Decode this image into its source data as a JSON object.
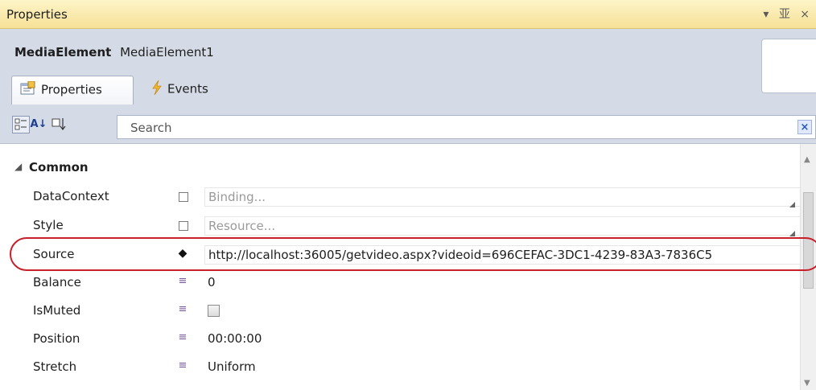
{
  "window": {
    "title": "Properties",
    "icons": {
      "dropdown": "▾",
      "pin": "业",
      "close": "×"
    }
  },
  "element": {
    "type": "MediaElement",
    "name": "MediaElement1"
  },
  "tabs": [
    {
      "label": "Properties",
      "icon": "properties-icon",
      "active": true
    },
    {
      "label": "Events",
      "icon": "lightning-icon",
      "active": false
    }
  ],
  "toolbar": {
    "alpha_glyph": "A↓",
    "search_placeholder": "Search",
    "clear_glyph": "×"
  },
  "category": {
    "label": "Common",
    "expanded": true
  },
  "properties": [
    {
      "name": "DataContext",
      "value": "Binding...",
      "marker": "square",
      "hint": true
    },
    {
      "name": "Style",
      "value": "Resource...",
      "marker": "square",
      "hint": true
    },
    {
      "name": "Source",
      "value": "http://localhost:36005/getvideo.aspx?videoid=696CEFAC-3DC1-4239-83A3-7836C5",
      "marker": "diamond",
      "hint": false
    },
    {
      "name": "Balance",
      "value": "0",
      "marker": "lines",
      "hint": false
    },
    {
      "name": "IsMuted",
      "value": "",
      "marker": "lines",
      "checkbox": true
    },
    {
      "name": "Position",
      "value": "00:00:00",
      "marker": "lines",
      "hint": false
    },
    {
      "name": "Stretch",
      "value": "Uniform",
      "marker": "lines",
      "hint": false
    }
  ],
  "colors": {
    "titlebar": "#f6e196",
    "header": "#d5dbe6",
    "highlight": "#c8202a"
  }
}
